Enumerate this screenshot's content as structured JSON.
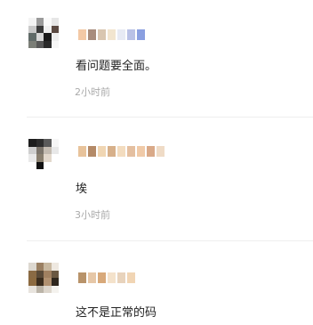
{
  "comments": [
    {
      "text": "看问题要全面。",
      "time": "2小时前",
      "avatar_colors": [
        "#f4f4f4",
        "#9a9a9a",
        "#fafafa",
        "#e6e6e6",
        "#c9c9c9",
        "#3a3a3a",
        "#f0f0f0",
        "#5b4a42",
        "#606a68",
        "#d8d8d8",
        "#1b1b1b",
        "#ededed",
        "#7b7e77",
        "#585858",
        "#2a2a2a",
        "#f6f6f6"
      ],
      "name_colors": [
        "#f3c9a6",
        "#a88c7c",
        "#d9c6b0",
        "#f2e5cf",
        "#e7eaf4",
        "#b9c1e6",
        "#8a9fe0"
      ]
    },
    {
      "text": "埃",
      "time": "3小时前",
      "avatar_colors": [
        "#1d1d1d",
        "#2c2c2c",
        "#5a5a5a",
        "#f6f6f6",
        "#cfcfcf",
        "#7c756c",
        "#c4bcb2",
        "#e8e8e8",
        "#e9e9e9",
        "#8a8070",
        "#e2d8cc",
        "#ffffff",
        "#ffffff",
        "#121212",
        "#ffffff",
        "#ffffff"
      ],
      "name_colors": [
        "#e8c39b",
        "#b48a67",
        "#f0d6b3",
        "#d7b08a",
        "#f3dcbf",
        "#e4bfa0",
        "#f0caa8",
        "#d9a988",
        "#efdbc6"
      ]
    },
    {
      "text": "这不是正常的码",
      "time": "",
      "avatar_colors": [
        "#ddd8d0",
        "#9a7f62",
        "#c8b8a0",
        "#eee8e0",
        "#8a6a44",
        "#5a4a38",
        "#a08060",
        "#6a5842",
        "#8c6a40",
        "#3b2d1e",
        "#b09070",
        "#2e261d",
        "#e8e4de",
        "#bbb4a8",
        "#ddd6cc",
        "#f4f2ee"
      ],
      "name_colors": [
        "#b8936a",
        "#e6c7a7",
        "#d8a97a",
        "#f4e2cb",
        "#e8d3bc",
        "#f1d5b4"
      ]
    }
  ]
}
